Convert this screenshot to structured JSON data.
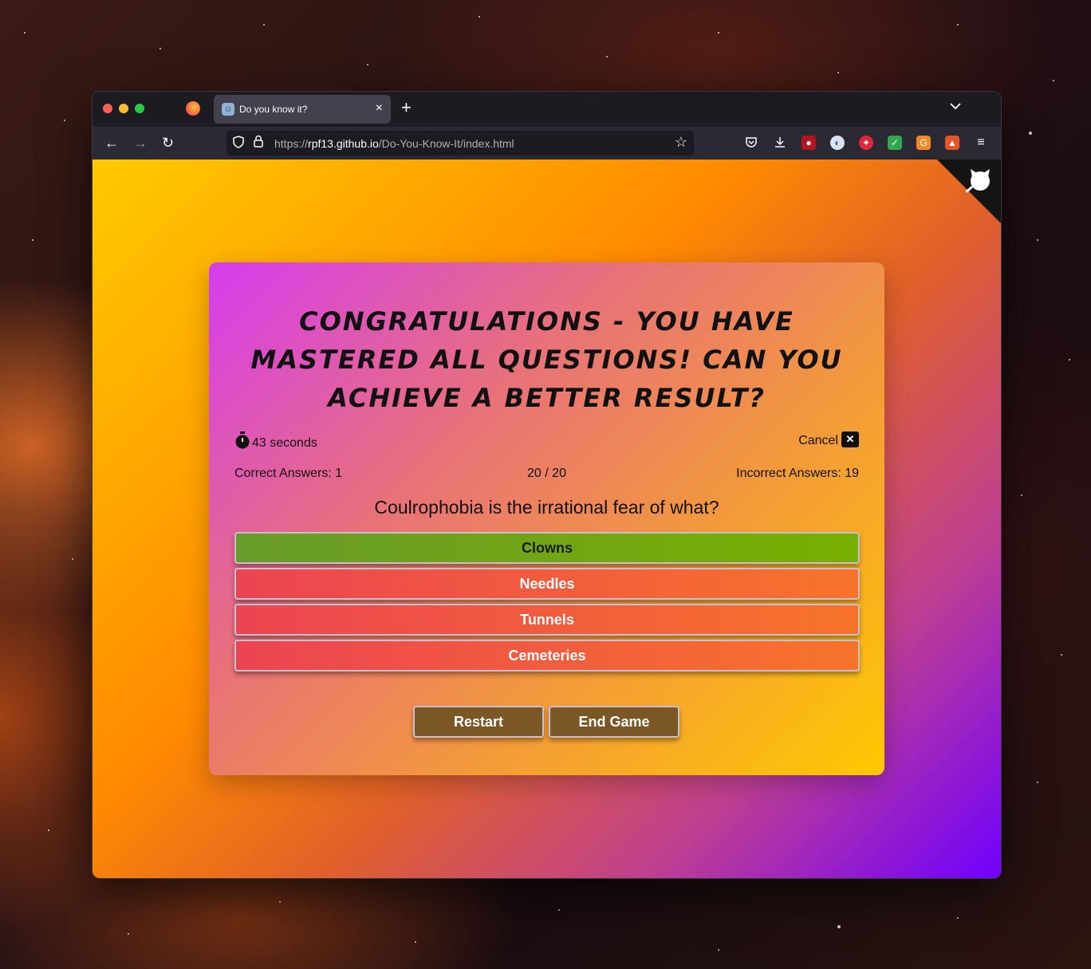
{
  "browser": {
    "tab_title": "Do you know it?",
    "tab_close": "×",
    "new_tab": "+",
    "url_scheme": "https://",
    "url_host": "rpf13.github.io",
    "url_path": "/Do-You-Know-It/index.html"
  },
  "quiz": {
    "heading": "Congratulations - you have mastered all questions! Can you achieve a better result?",
    "timer_text": "43 seconds",
    "cancel_label": "Cancel",
    "correct_label": "Correct Answers: 1",
    "progress": "20 / 20",
    "incorrect_label": "Incorrect Answers: 19",
    "question": "Coulrophobia is the irrational fear of what?",
    "answers": [
      "Clowns",
      "Needles",
      "Tunnels",
      "Cemeteries"
    ],
    "restart_label": "Restart",
    "end_game_label": "End Game"
  },
  "colors": {
    "correct": "#78b000",
    "wrong": "#ec4452",
    "button": "#7b5725"
  }
}
